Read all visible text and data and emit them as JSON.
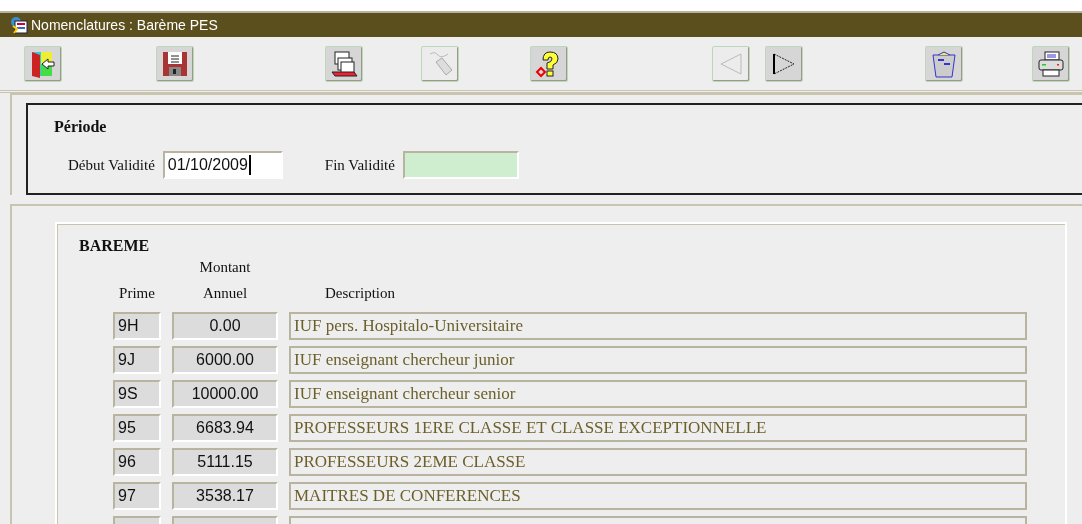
{
  "window": {
    "title": "Nomenclatures : Barème PES"
  },
  "toolbar": [
    {
      "kind": "exit",
      "disabled": false
    },
    {
      "kind": "save",
      "disabled": false
    },
    {
      "kind": "print-preview",
      "disabled": false
    },
    {
      "kind": "eraser",
      "disabled": true
    },
    {
      "kind": "help",
      "disabled": false
    },
    {
      "kind": "previous",
      "disabled": true
    },
    {
      "kind": "next",
      "disabled": false
    },
    {
      "kind": "trash",
      "disabled": false
    },
    {
      "kind": "print",
      "disabled": false
    }
  ],
  "periode": {
    "title": "Période",
    "start_label": "Début Validité",
    "start_value": "01/10/2009",
    "end_label": "Fin Validité"
  },
  "bareme": {
    "title": "BAREME",
    "columns": [
      {
        "lines": [
          "Prime"
        ]
      },
      {
        "lines": [
          "Montant",
          "Annuel"
        ]
      },
      {
        "lines": [
          "Description"
        ]
      }
    ],
    "rows": [
      {
        "kind": "filled",
        "prime": "9H",
        "montant": "0.00",
        "description": "IUF pers. Hospitalo-Universitaire"
      },
      {
        "kind": "filled",
        "prime": "9J",
        "montant": "6000.00",
        "description": "IUF enseignant chercheur junior"
      },
      {
        "kind": "filled",
        "prime": "9S",
        "montant": "10000.00",
        "description": "IUF enseignant chercheur senior"
      },
      {
        "kind": "filled",
        "prime": "95",
        "montant": "6683.94",
        "description": "PROFESSEURS 1ERE CLASSE ET CLASSE EXCEPTIONNELLE"
      },
      {
        "kind": "filled",
        "prime": "96",
        "montant": "5111.15",
        "description": "PROFESSEURS 2EME CLASSE"
      },
      {
        "kind": "filled",
        "prime": "97",
        "montant": "3538.17",
        "description": "MAITRES DE CONFERENCES"
      },
      {
        "kind": "empty"
      }
    ]
  }
}
